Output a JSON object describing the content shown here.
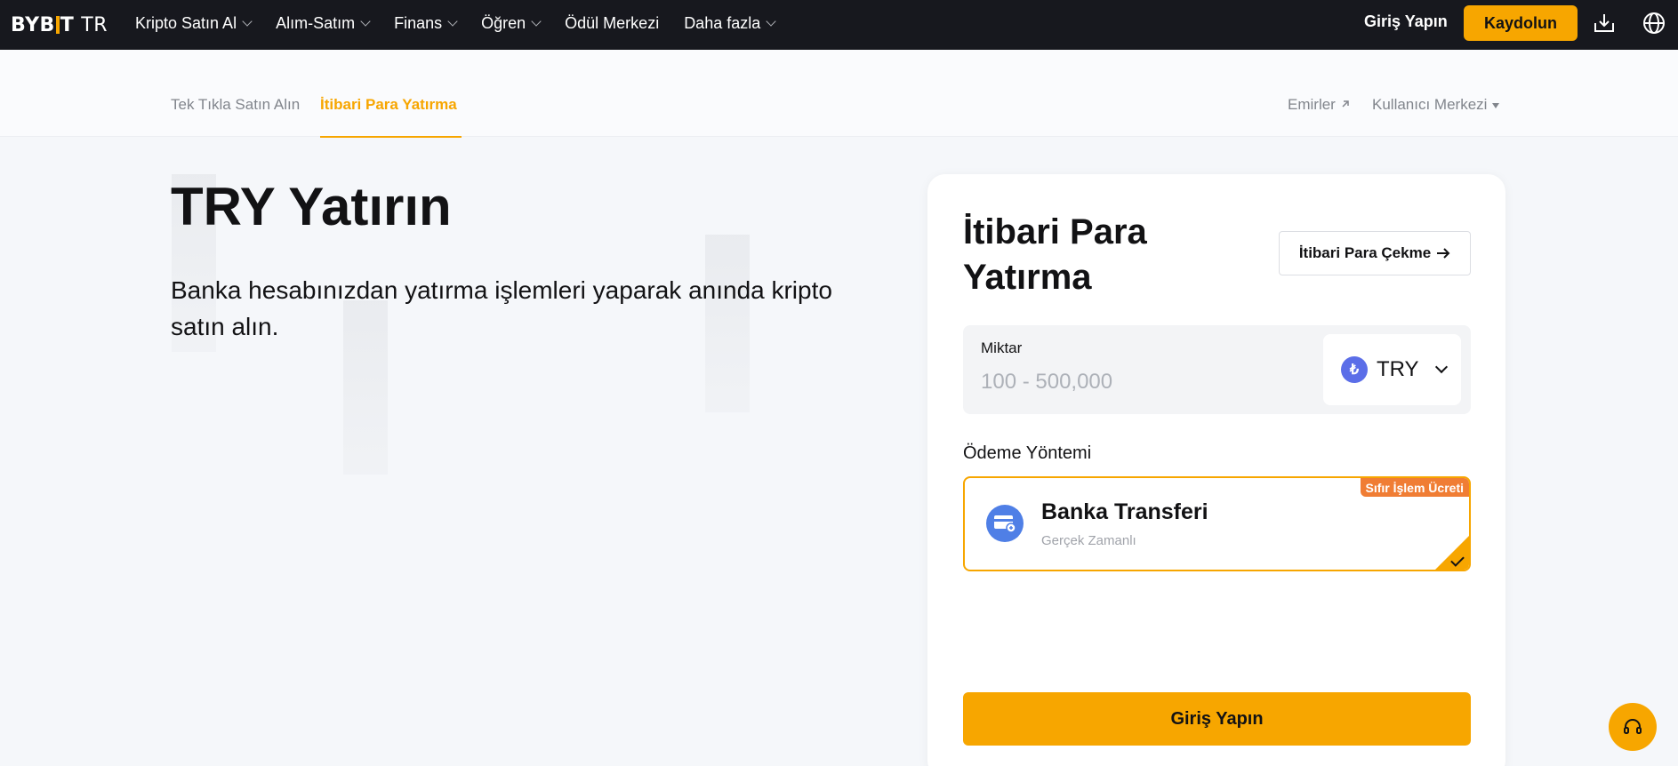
{
  "header": {
    "logo_text": "BYB",
    "logo_text_end": "T",
    "logo_suffix": "TR",
    "nav": [
      {
        "label": "Kripto Satın Al",
        "icon": "chevron-down-icon"
      },
      {
        "label": "Alım-Satım",
        "icon": "chevron-down-icon"
      },
      {
        "label": "Finans",
        "icon": "chevron-down-icon"
      },
      {
        "label": "Öğren",
        "icon": "chevron-down-icon"
      },
      {
        "label": "Ödül Merkezi"
      },
      {
        "label": "Daha fazla",
        "icon": "chevron-down-icon"
      }
    ],
    "login_label": "Giriş Yapın",
    "signup_label": "Kaydolun",
    "download_icon": "download-icon",
    "language_icon": "globe-icon"
  },
  "subnav": {
    "tabs": [
      {
        "label": "Tek Tıkla Satın Alın",
        "active": false
      },
      {
        "label": "İtibari Para Yatırma",
        "active": true
      }
    ],
    "orders_label": "Emirler",
    "user_center_label": "Kullanıcı Merkezi"
  },
  "hero": {
    "title": "TRY Yatırın",
    "subtitle": "Banka hesabınızdan yatırma işlemleri yaparak anında kripto satın alın."
  },
  "card": {
    "title": "İtibari Para Yatırma",
    "withdraw_label": "İtibari Para Çekme",
    "amount_label": "Miktar",
    "amount_placeholder": "100 - 500,000",
    "amount_value": "",
    "currency": "TRY",
    "currency_symbol": "₺",
    "payment_method_label": "Ödeme Yöntemi",
    "payment_option": {
      "title": "Banka Transferi",
      "subtitle": "Gerçek Zamanlı",
      "badge": "Sıfır İşlem Ücreti",
      "selected": true
    },
    "login_button": "Giriş Yapın"
  },
  "colors": {
    "accent": "#f7a600",
    "topbar": "#17181e",
    "badge": "#f07d34",
    "bank_icon": "#4f7fe6",
    "currency_icon": "#5b6ee8"
  },
  "support_icon": "headset-icon"
}
